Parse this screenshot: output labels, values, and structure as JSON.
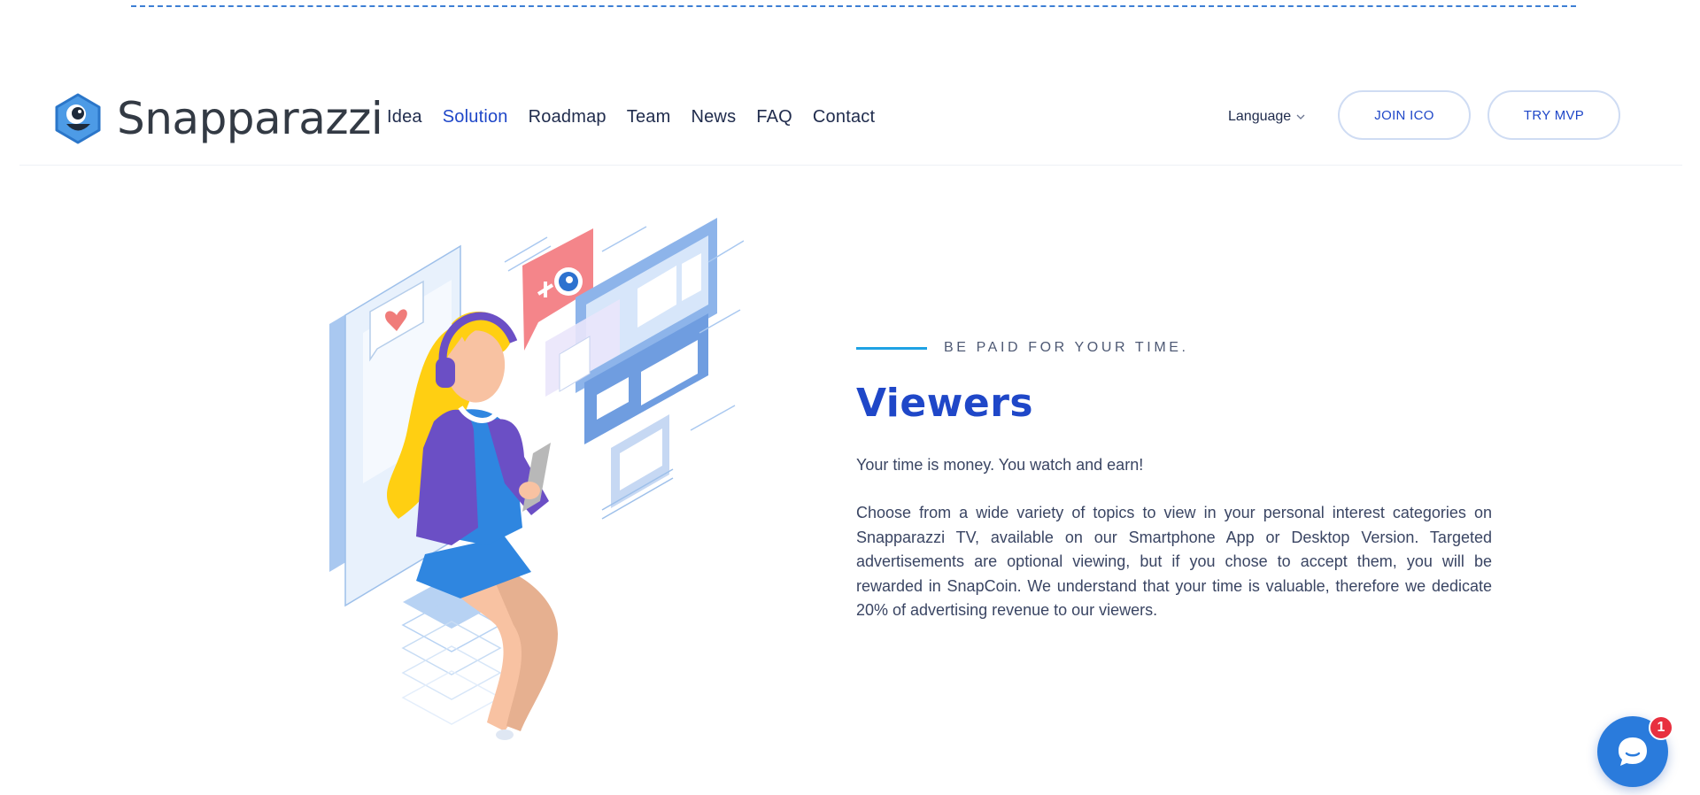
{
  "brand": {
    "name": "Snapparazzi",
    "logo_icon": "snapparazzi-eye-logo"
  },
  "nav": {
    "items": [
      {
        "label": "Idea",
        "active": false
      },
      {
        "label": "Solution",
        "active": true
      },
      {
        "label": "Roadmap",
        "active": false
      },
      {
        "label": "Team",
        "active": false
      },
      {
        "label": "News",
        "active": false
      },
      {
        "label": "FAQ",
        "active": false
      },
      {
        "label": "Contact",
        "active": false
      }
    ]
  },
  "header": {
    "language_label": "Language",
    "language_icon": "chevron-down-icon",
    "join_label": "JOIN ICO",
    "try_label": "TRY MVP"
  },
  "section": {
    "eyebrow": "BE PAID FOR YOUR TIME.",
    "title": "Viewers",
    "lead": "Your time is money. You watch and earn!",
    "body": "Choose from a wide variety of topics to view in your personal interest categories on Snapparazzi TV, available on our Smartphone App or Desktop Version. Targeted advertisements are optional viewing, but if you chose to accept them, you will be rewarded in SnapCoin. We understand that your time is valuable, therefore we dedicate 20% of advertising revenue to our viewers."
  },
  "chat": {
    "icon": "chat-bubble-icon",
    "unread_count": "1"
  },
  "colors": {
    "accent": "#1f47c8",
    "eyebrow_line": "#1fa2e4",
    "chat_button": "#2a7bdc",
    "badge": "#e8303f"
  }
}
